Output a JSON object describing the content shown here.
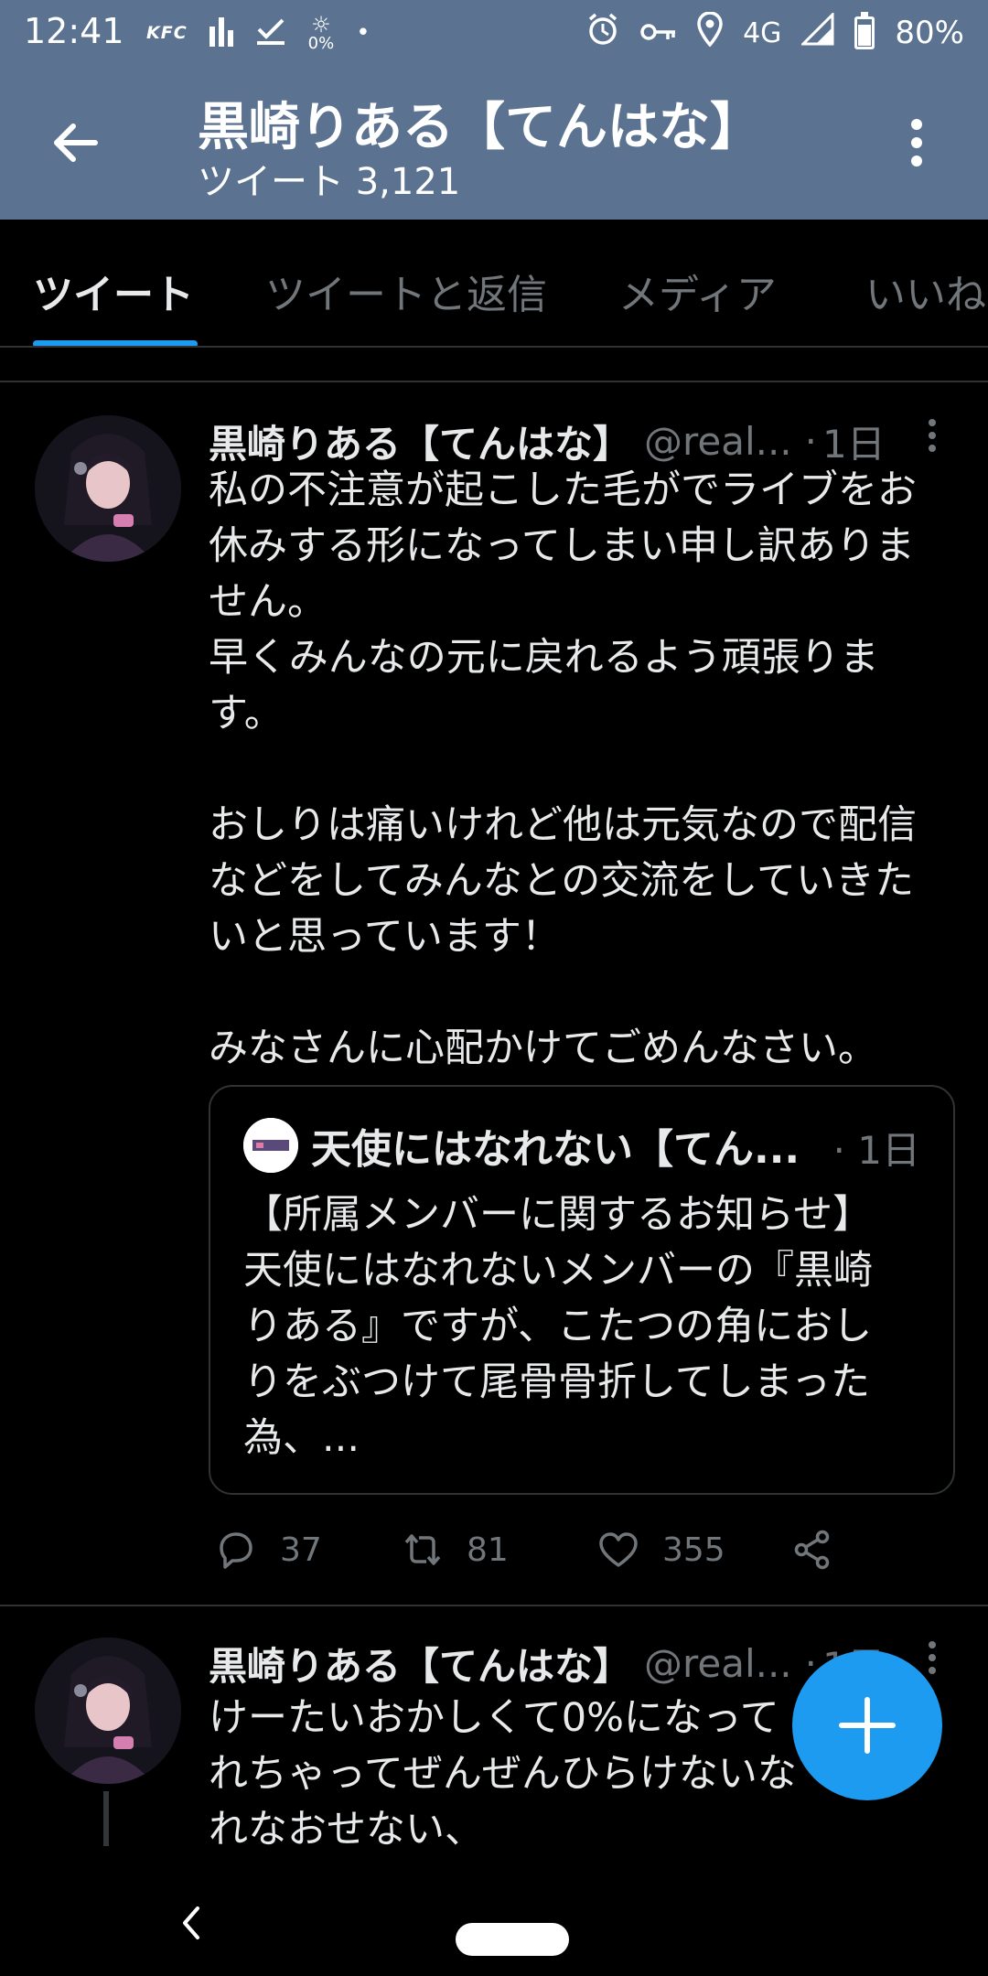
{
  "status_bar": {
    "time": "12:41",
    "left_icons": [
      "KFC",
      "signal-bars-icon",
      "download-done-icon",
      "brightness-icon",
      "dot-icon"
    ],
    "kfc": "KFC",
    "brightness_value": "0%",
    "network": "4G",
    "battery": "80%",
    "battery_level": 0.8,
    "right_icons": [
      "alarm-icon",
      "key-icon",
      "location-icon",
      "cell-signal-icon",
      "battery-icon"
    ]
  },
  "header": {
    "title": "黒崎りある【てんはな】",
    "subtitle": "ツイート 3,121"
  },
  "tabs": [
    {
      "label": "ツイート",
      "active": true
    },
    {
      "label": "ツイートと返信",
      "active": false
    },
    {
      "label": "メディア",
      "active": false
    },
    {
      "label": "いいね",
      "active": false
    }
  ],
  "tweets": [
    {
      "name": "黒崎りある【てんはな】",
      "handle": "@real...",
      "time": "1日",
      "text": "私の不注意が起こした毛がでライブをお\n休みする形になってしまい申し訳ありま\nせん。\n早くみんなの元に戻れるよう頑張りま\nす。\n\nおしりは痛いけれど他は元気なので配信\nなどをしてみんなとの交流をしていきた\nいと思っています！\n\nみなさんに心配かけてごめんなさい。",
      "quote": {
        "name": "天使にはなれない【てん...",
        "time": "· 1日",
        "text": "【所属メンバーに関するお知らせ】\n天使にはなれないメンバーの『黒崎\nりある』ですが、こたつの角におし\nりをぶつけて尾骨骨折してしまった\n為、..."
      },
      "replies": "37",
      "retweets": "81",
      "likes": "355"
    },
    {
      "name": "黒崎りある【てんはな】",
      "handle": "@real...",
      "time": "1日",
      "text": "けーたいおかしくて0%になって\nれちゃってぜんぜんひらけないな\nれなおせない、"
    }
  ],
  "colors": {
    "header_bg": "#5b7391",
    "accent": "#1d9bf0",
    "background": "#000000",
    "secondary_text": "#71767b"
  }
}
